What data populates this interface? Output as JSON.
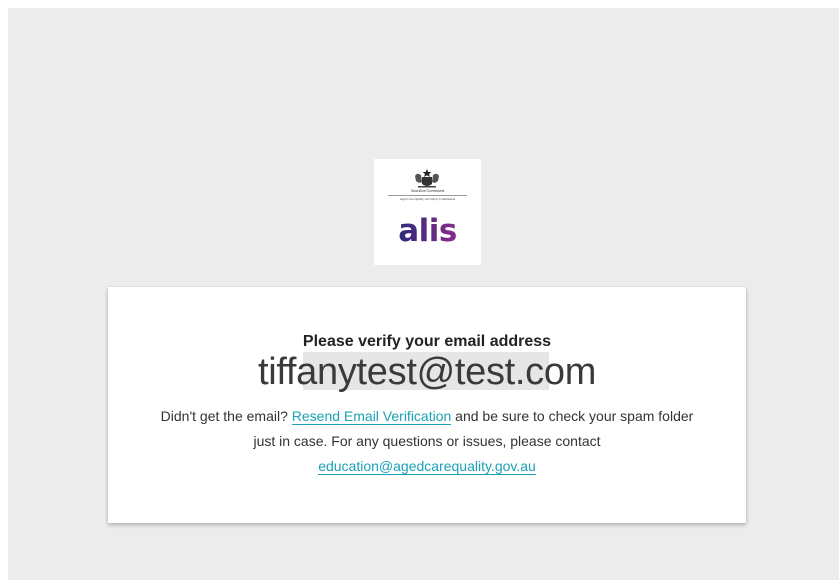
{
  "logo": {
    "gov_line1": "Australian Government",
    "gov_line2": "Aged Care Quality and Safety Commission",
    "brand": "alis",
    "brand_color_start": "#2e2a7a",
    "brand_color_end": "#8a2a8a"
  },
  "card": {
    "heading": "Please verify your email address",
    "email": "tiffanytest@test.com",
    "text_before_link": "Didn't get the email? ",
    "resend_link": "Resend Email Verification",
    "text_after_link": " and be sure to check your spam folder just in case. For any questions or issues, please contact ",
    "contact_email": "education@agedcarequality.gov.au",
    "link_color": "#1aa2b6"
  }
}
